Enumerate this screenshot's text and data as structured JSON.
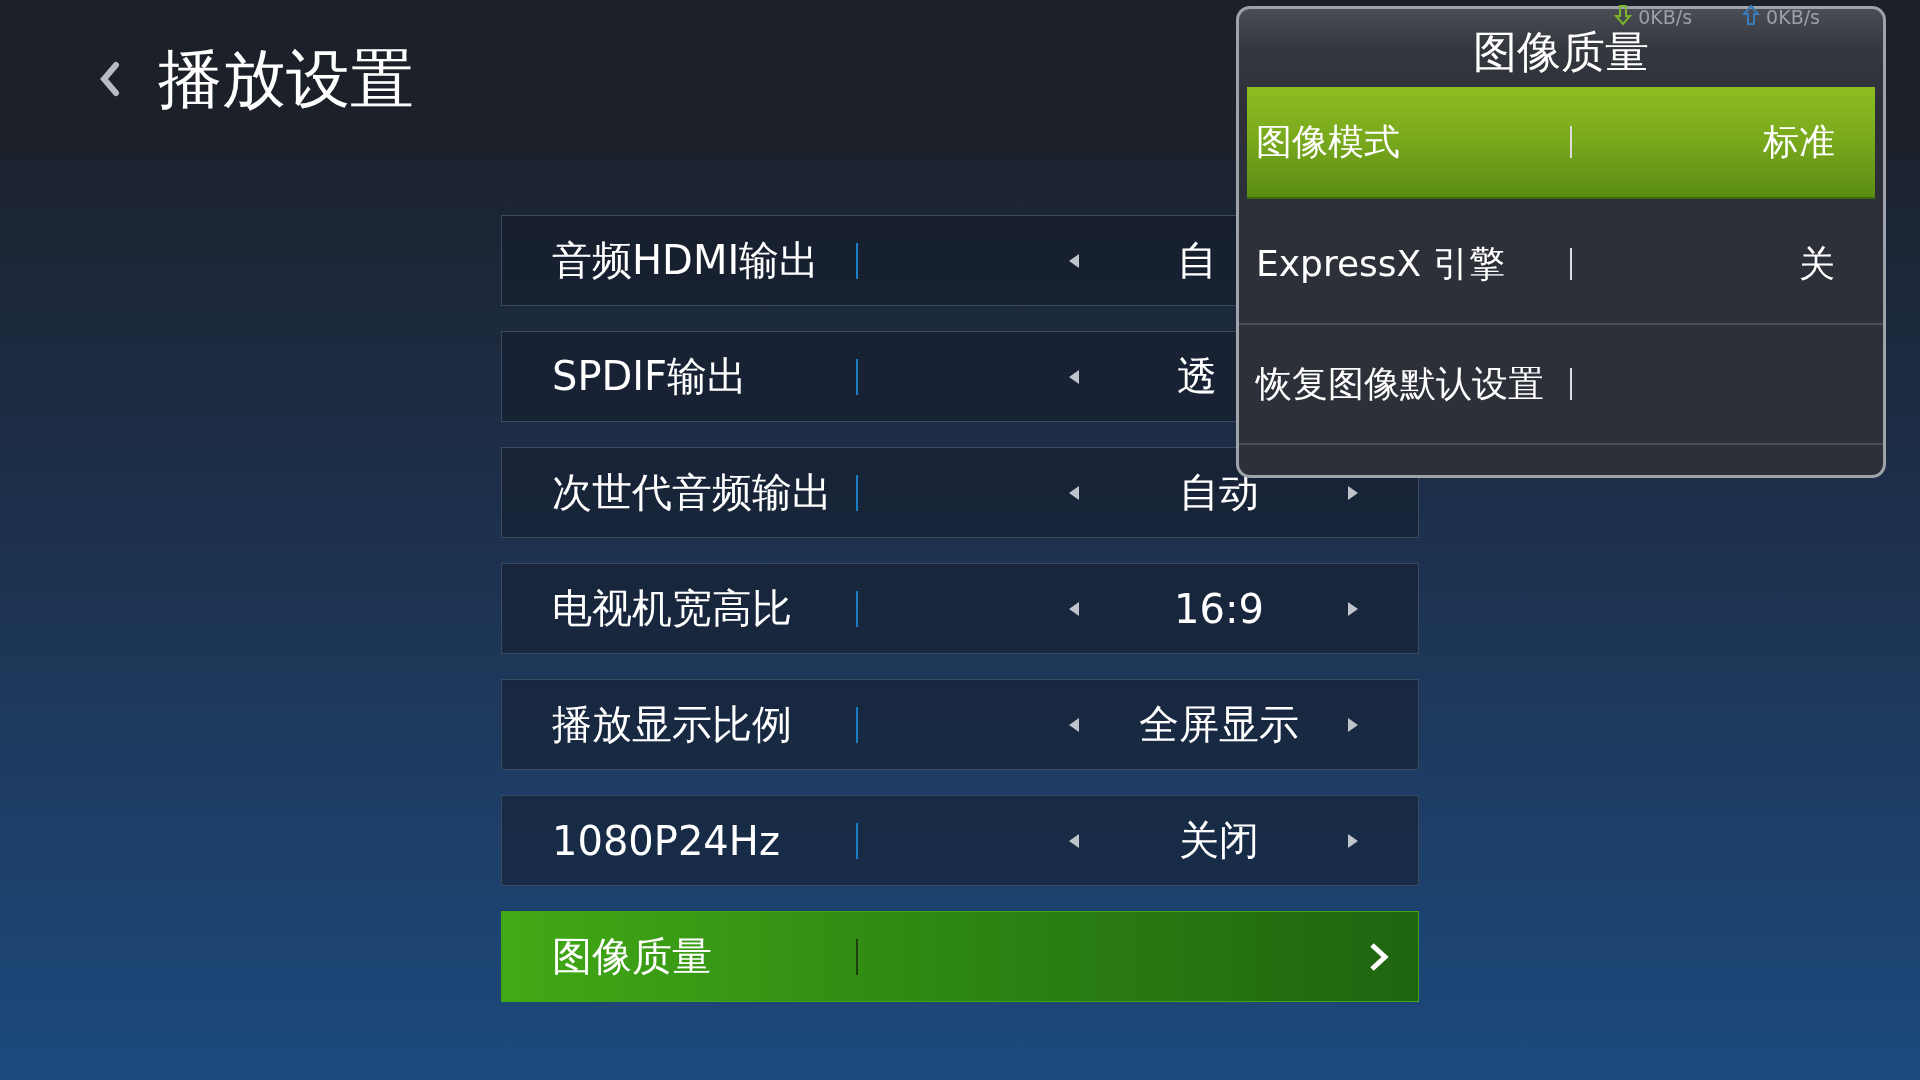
{
  "header": {
    "title": "播放设置"
  },
  "settings": [
    {
      "kind": "partial",
      "label": "音频HDMI输出",
      "value": "自",
      "selected": false
    },
    {
      "kind": "partial",
      "label": "SPDIF输出",
      "value": "透",
      "selected": false
    },
    {
      "kind": "option",
      "label": "次世代音频输出",
      "value": "自动",
      "selected": false
    },
    {
      "kind": "option",
      "label": "电视机宽高比",
      "value": "16:9",
      "selected": false
    },
    {
      "kind": "option",
      "label": "播放显示比例",
      "value": "全屏显示",
      "selected": false
    },
    {
      "kind": "option",
      "label": "1080P24Hz",
      "value": "关闭",
      "selected": false
    },
    {
      "kind": "submenu",
      "label": "图像质量",
      "selected": true
    }
  ],
  "status_bar": [
    {
      "kind": "download",
      "rate": "0KB/s"
    },
    {
      "kind": "upload",
      "rate": "0KB/s"
    }
  ],
  "dialog": {
    "title": "图像质量",
    "items": [
      {
        "label": "图像模式",
        "value": "标准",
        "selected": true
      },
      {
        "label": "ExpressX 引擎",
        "value": "关",
        "selected": false
      },
      {
        "label": "恢复图像默认设置",
        "selected": false
      }
    ]
  }
}
